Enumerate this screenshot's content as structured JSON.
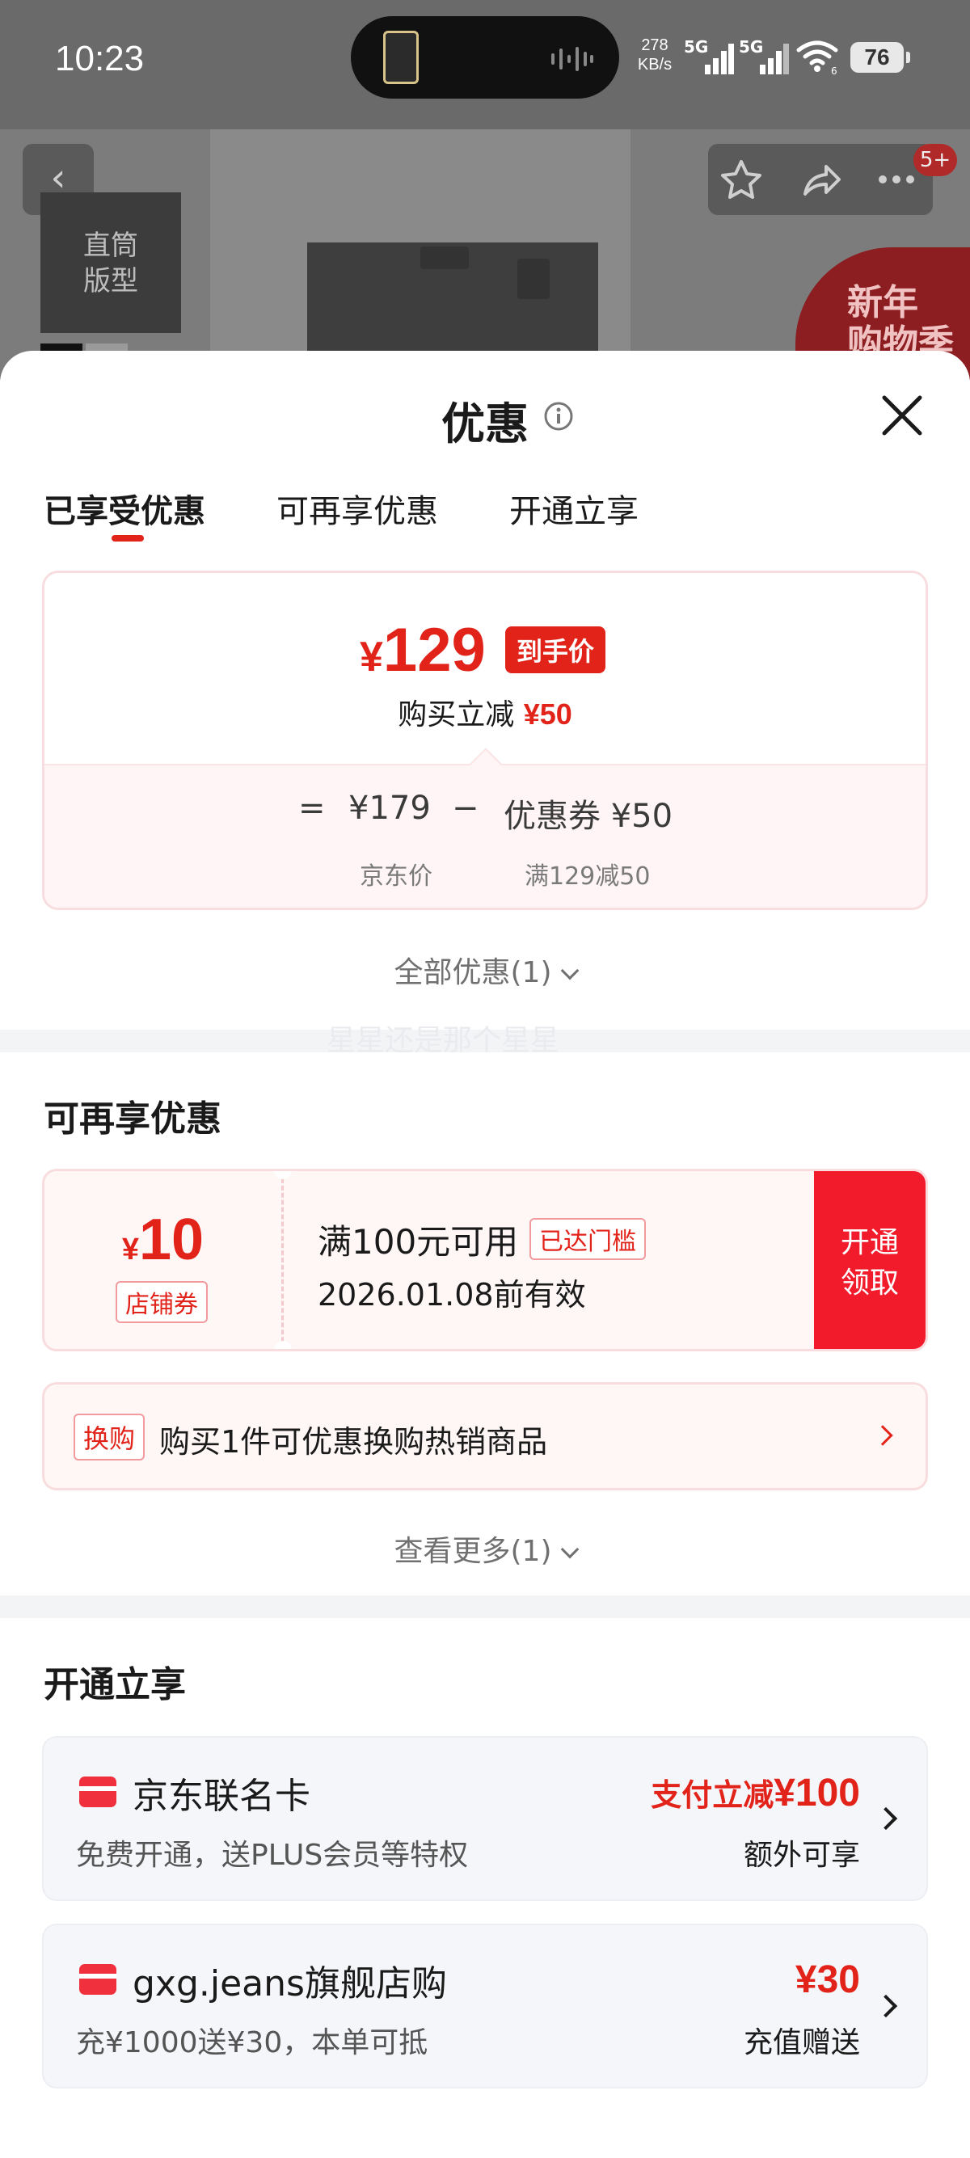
{
  "status_bar": {
    "time": "10:23",
    "net_speed_value": "278",
    "net_speed_unit": "KB/s",
    "signal_1": "5G",
    "signal_2": "5G",
    "wifi_sub": "6",
    "battery": "76"
  },
  "background": {
    "style_tag": "直筒\n版型",
    "cart_badge": "5+",
    "promo_corner": "新年\n购物季"
  },
  "sheet": {
    "title": "优惠",
    "tabs": [
      {
        "label": "已享受优惠",
        "active": true
      },
      {
        "label": "可再享优惠",
        "active": false
      },
      {
        "label": "开通立享",
        "active": false
      }
    ]
  },
  "price_breakdown": {
    "currency": "¥",
    "final_price": "129",
    "final_label": "到手价",
    "reduce_label": "购买立减",
    "reduce_amount": "¥50",
    "equals": "=",
    "jd_price": "¥179",
    "minus": "−",
    "coupon_label": "优惠券 ¥50",
    "jd_price_label": "京东价",
    "coupon_rule": "满129减50"
  },
  "all_offers_link": "全部优惠(1)",
  "watermark": "星星还是那个星星",
  "more_offers": {
    "title": "可再享优惠",
    "coupon": {
      "currency": "¥",
      "amount": "10",
      "type": "店铺券",
      "condition": "满100元可用",
      "status_tag": "已达门槛",
      "expiry": "2026.01.08前有效",
      "action": "开通\n领取"
    },
    "swap": {
      "tag": "换购",
      "text": "购买1件可优惠换购热销商品"
    },
    "view_more": "查看更多(1)"
  },
  "open_benefits": {
    "title": "开通立享",
    "items": [
      {
        "title": "京东联名卡",
        "subtitle": "免费开通，送PLUS会员等特权",
        "amount_prefix": "支付立减",
        "amount": "¥100",
        "note": "额外可享"
      },
      {
        "title": "gxg.jeans旗舰店购",
        "subtitle": "充¥1000送¥30，本单可抵",
        "amount_prefix": "",
        "amount": "¥30",
        "note": "充值赠送"
      }
    ]
  },
  "colors": {
    "accent_red": "#e2231a",
    "button_red": "#f21b2c",
    "coupon_bg": "#fff6f6"
  }
}
